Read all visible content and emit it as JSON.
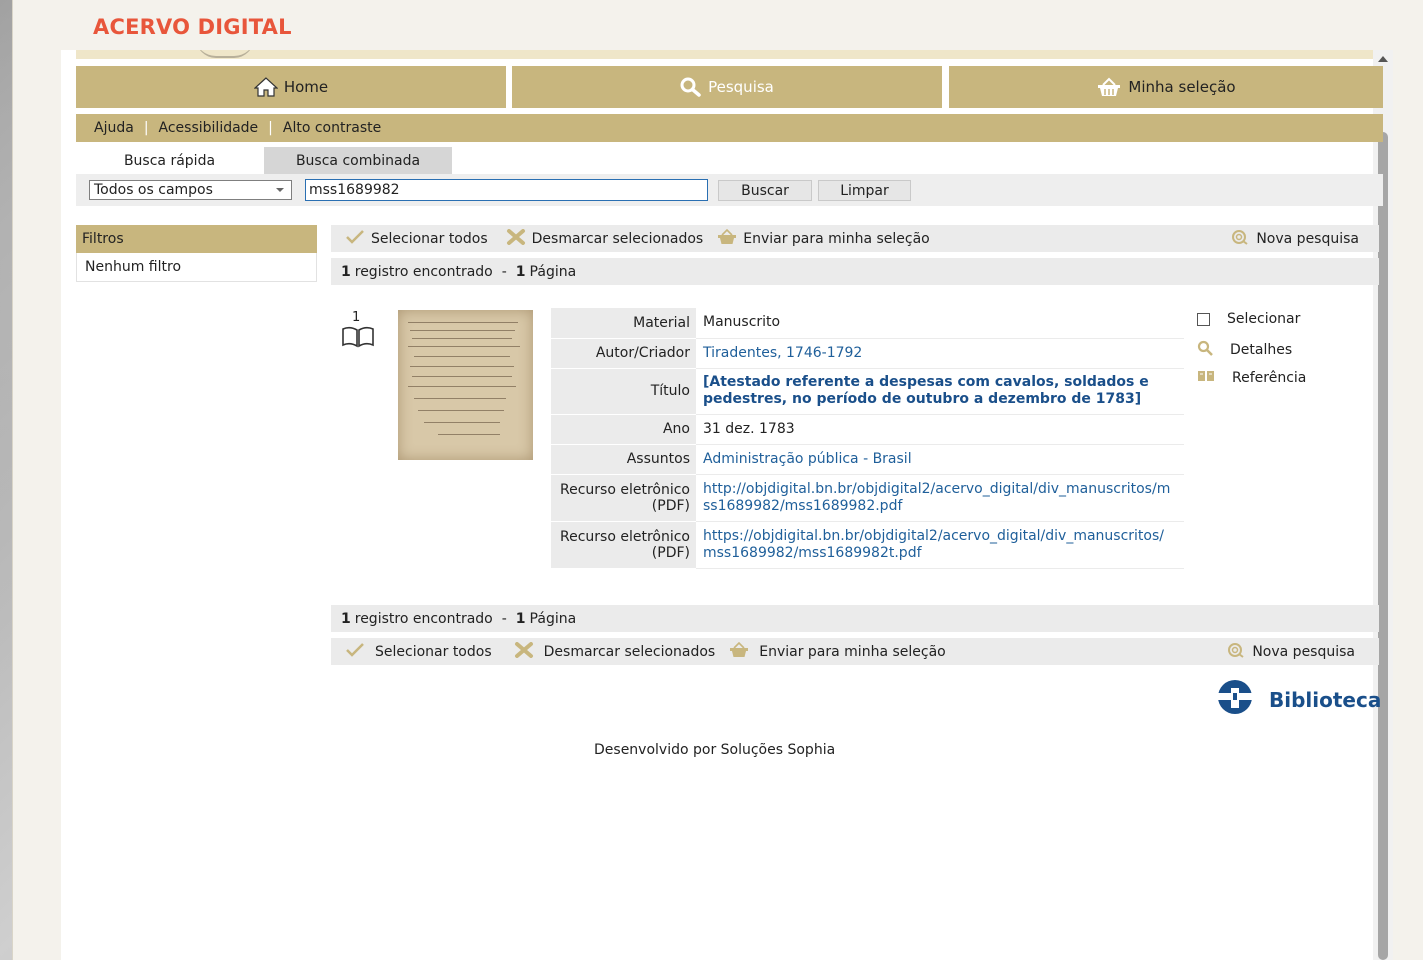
{
  "app": {
    "title": "ACERVO DIGITAL"
  },
  "nav": {
    "home": "Home",
    "search": "Pesquisa",
    "selection": "Minha seleção"
  },
  "util": {
    "help": "Ajuda",
    "accessibility": "Acessibilidade",
    "contrast": "Alto contraste",
    "sep": "|"
  },
  "tabs": {
    "quick": "Busca rápida",
    "combined": "Busca combinada"
  },
  "search": {
    "field": "Todos os campos",
    "query": "mss1689982",
    "buscar": "Buscar",
    "limpar": "Limpar"
  },
  "filters": {
    "title": "Filtros",
    "none": "Nenhum filtro"
  },
  "actions": {
    "select_all": "Selecionar todos",
    "deselect": "Desmarcar selecionados",
    "send": "Enviar para minha seleção",
    "new_search": "Nova pesquisa"
  },
  "results": {
    "count": "1",
    "count_label": "registro encontrado",
    "dash": "-",
    "pages": "1",
    "pages_label": "Página"
  },
  "record": {
    "number": "1",
    "fields": [
      {
        "label": "Material",
        "value": "Manuscrito"
      },
      {
        "label": "Autor/Criador",
        "value": "Tiradentes, 1746-1792"
      },
      {
        "label": "Título",
        "value": "[Atestado referente a despesas com cavalos, soldados e pedestres, no período de outubro a dezembro de 1783]"
      },
      {
        "label": "Ano",
        "value": "31 dez. 1783"
      },
      {
        "label": "Assuntos",
        "value": "Administração pública - Brasil"
      },
      {
        "label": "Recurso eletrônico (PDF)",
        "value": "http://objdigital.bn.br/objdigital2/acervo_digital/div_manuscritos/mss1689982/mss1689982.pdf"
      },
      {
        "label": "Recurso eletrônico (PDF)",
        "value": "https://objdigital.bn.br/objdigital2/acervo_digital/div_manuscritos/mss1689982/mss1689982t.pdf"
      }
    ],
    "side": {
      "select": "Selecionar",
      "details": "Detalhes",
      "reference": "Referência"
    }
  },
  "brand": {
    "biblioteca": "Biblioteca"
  },
  "footer": {
    "text": "Desenvolvido por Soluções Sophia"
  },
  "colors": {
    "accent": "#c8b67e",
    "title": "#e8563b",
    "link": "#1f5f9a"
  },
  "icons": [
    "home-icon",
    "search-icon",
    "basket-icon",
    "check-icon",
    "x-icon",
    "new-search-icon",
    "book-icon",
    "magnifier-icon",
    "reference-icon",
    "biblioteca-logo-icon"
  ]
}
